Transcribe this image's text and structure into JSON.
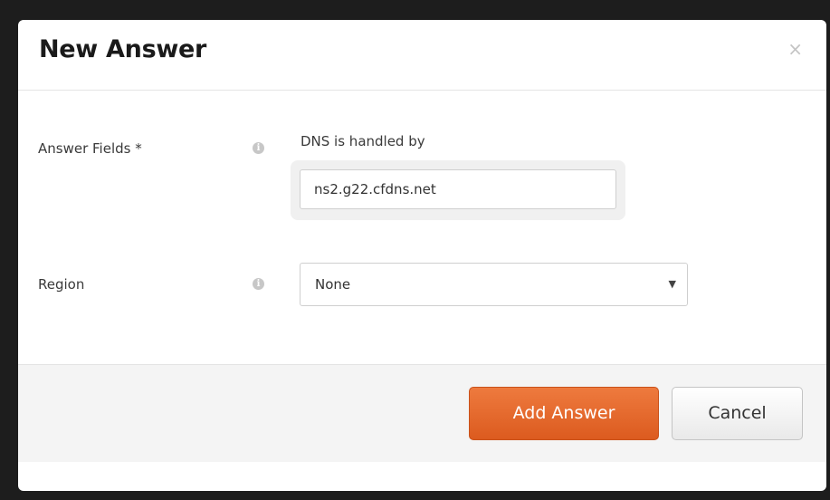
{
  "modal": {
    "title": "New Answer",
    "close_glyph": "×"
  },
  "form": {
    "answer_fields": {
      "label": "Answer Fields *",
      "info_icon": "info-circle-icon",
      "sub_label": "DNS is handled by",
      "value": "ns2.g22.cfdns.net"
    },
    "region": {
      "label": "Region",
      "info_icon": "info-circle-icon",
      "selected": "None",
      "caret": "▼"
    }
  },
  "footer": {
    "primary_label": "Add Answer",
    "cancel_label": "Cancel"
  },
  "colors": {
    "primary": "#e4682c",
    "backdrop": "#1d1d1d"
  }
}
